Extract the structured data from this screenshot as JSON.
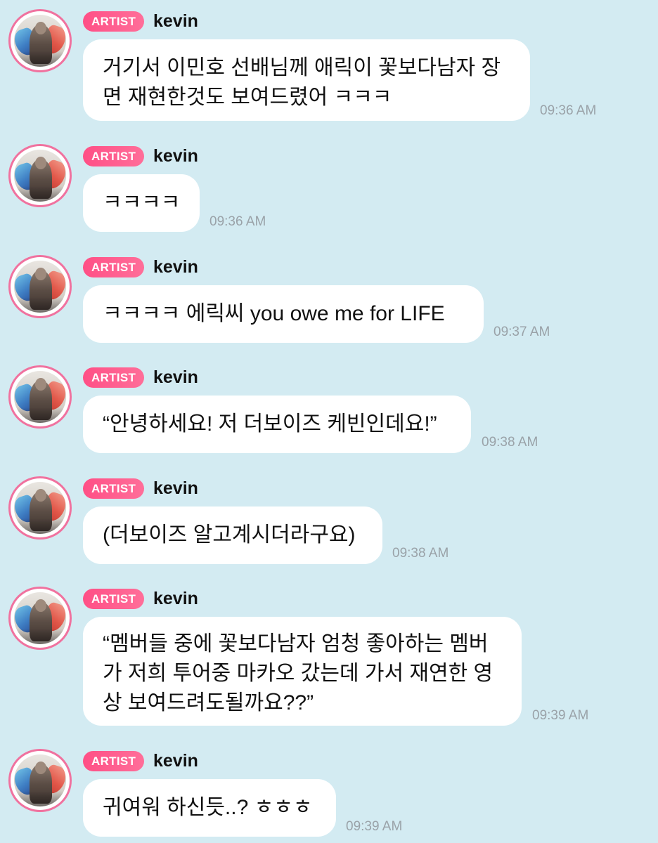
{
  "messages": [
    {
      "badge": "ARTIST",
      "sender": "kevin",
      "lines": [
        "거기서 이민호 선배님께 애릭이 꽃보다남자 장",
        "면 재현한것도 보여드렸어 ㅋㅋㅋ"
      ],
      "time": "09:36 AM"
    },
    {
      "badge": "ARTIST",
      "sender": "kevin",
      "lines": [
        "ㅋㅋㅋㅋ"
      ],
      "time": "09:36 AM"
    },
    {
      "badge": "ARTIST",
      "sender": "kevin",
      "lines": [
        "ㅋㅋㅋㅋ 에릭씨 you owe me for LIFE"
      ],
      "time": "09:37 AM"
    },
    {
      "badge": "ARTIST",
      "sender": "kevin",
      "lines": [
        "“안녕하세요! 저 더보이즈 케빈인데요!”"
      ],
      "time": "09:38 AM"
    },
    {
      "badge": "ARTIST",
      "sender": "kevin",
      "lines": [
        "(더보이즈 알고계시더라구요)"
      ],
      "time": "09:38 AM"
    },
    {
      "badge": "ARTIST",
      "sender": "kevin",
      "lines": [
        "“멤버들 중에 꽃보다남자 엄청 좋아하는 멤버",
        "가 저희 투어중 마카오 갔는데 가서 재연한 영",
        "상 보여드려도될까요??”"
      ],
      "time": "09:39 AM"
    },
    {
      "badge": "ARTIST",
      "sender": "kevin",
      "lines": [
        "귀여워 하신듯..? ㅎㅎㅎ"
      ],
      "time": "09:39 AM"
    }
  ]
}
